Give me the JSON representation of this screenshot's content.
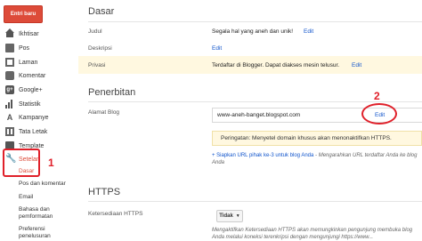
{
  "sidebar": {
    "new_post": "Entri baru",
    "items": [
      {
        "label": "Ikhtisar",
        "icon": "home-icon"
      },
      {
        "label": "Pos",
        "icon": "post-icon"
      },
      {
        "label": "Laman",
        "icon": "page-icon"
      },
      {
        "label": "Komentar",
        "icon": "comment-icon"
      },
      {
        "label": "Google+",
        "icon": "google-plus-icon"
      },
      {
        "label": "Statistik",
        "icon": "stats-icon"
      },
      {
        "label": "Kampanye",
        "icon": "earnings-icon"
      },
      {
        "label": "Tata Letak",
        "icon": "layout-icon"
      },
      {
        "label": "Template",
        "icon": "template-icon"
      },
      {
        "label": "Setelan",
        "icon": "wrench-icon"
      }
    ],
    "sub_items": [
      {
        "label": "Dasar"
      },
      {
        "label": "Pos dan komentar"
      },
      {
        "label": "Email"
      },
      {
        "label": "Bahasa dan pemformatan"
      },
      {
        "label": "Preferensi penelusuran"
      }
    ]
  },
  "annotations": {
    "num1": "1",
    "num2": "2"
  },
  "main": {
    "dasar": {
      "title": "Dasar",
      "judul_label": "Judul",
      "judul_value": "Segala hal yang aneh dan unik!",
      "deskripsi_label": "Deskripsi",
      "privasi_label": "Privasi",
      "privasi_value": "Terdaftar di Blogger. Dapat diakses mesin telusur.",
      "edit": "Edit"
    },
    "penerbitan": {
      "title": "Penerbitan",
      "alamat_label": "Alamat Blog",
      "alamat_value": "www-aneh-banget.blogspot.com",
      "edit": "Edit",
      "warning": "Peringatan: Menyetel domain khusus akan menonaktifkan HTTPS.",
      "third_party_link": "+ Siapkan URL pihak ke-3 untuk blog Anda",
      "third_party_desc": " - Mengarahkan URL terdaftar Anda ke blog Anda"
    },
    "https": {
      "title": "HTTPS",
      "availability_label": "Ketersediaan HTTPS",
      "select_value": "Tidak",
      "description": "Mengaktifkan Ketersediaan HTTPS akan memungkinkan pengunjung membuka blog Anda melalui koneksi terenkripsi dengan mengunjungi https://www..."
    }
  },
  "colors": {
    "accent_red": "#dd4b39",
    "annotation_red": "#e0202a",
    "link_blue": "#1155cc",
    "highlight_yellow": "#fff8e0"
  }
}
